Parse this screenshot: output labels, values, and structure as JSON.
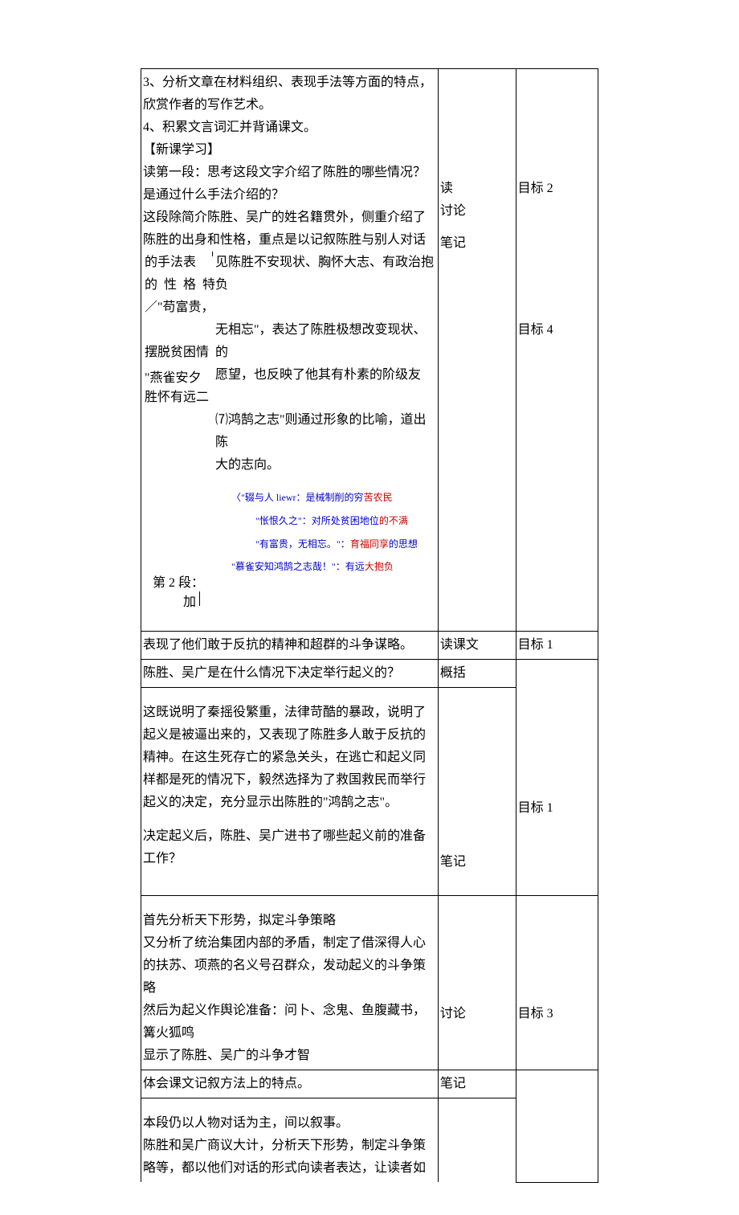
{
  "col1": {
    "points": {
      "p3": "3、分析文章在材料组织、表现手法等方面的特点，欣赏作者的写作艺术。",
      "p4": "4、积累文言词汇并背诵课文。"
    },
    "sectionHead": "【新课学习】",
    "q1": "读第一段：思考这段文字介绍了陈胜的哪些情况？是通过什么手法介绍的？",
    "block1": {
      "line1": "这段除简介陈胜、吴广的姓名籍贯外，侧重介绍了陈胜的出身和性格，重点是以记叙陈胜与别人对话",
      "left0": "的手法表",
      "right0": "见陈胜不安现状、胸怀大志、有政治抱负",
      "left1pre": "的 性 格 特",
      "left1": "／\"苟富贵，",
      "right1": "无相忘\"，表达了陈胜极想改变现状、的",
      "left2": "摆脱贫困情",
      "right2": "愿望，也反映了他其有朴素的阶级友",
      "left3a": "\"燕雀安夕",
      "left3b": "胜怀有远二",
      "right3a": "⑺鸿鹄之志\"则通过形象的比喻，道出陈",
      "right3b": "大的志向。"
    },
    "annot": {
      "a1a": "〈\"辍与人 liewr：是械制削的穷",
      "a1b": "苦农民",
      "a2a": "\"怅恨久之\"：对所处贫困地位",
      "a2b": "的不满",
      "a3a": "\"有富贵，无相忘。\"：",
      "a3b": "育福同享",
      "a3c": "的思想",
      "a4a": "\"慕雀安知鸿鹄之志哉！\"：有远",
      "a4b": "大抱负"
    },
    "footer": {
      "f1": "第 2 段：",
      "f2": "加"
    },
    "row2": "表现了他们敢于反抗的精神和超群的斗争谋略。",
    "row3": "陈胜、吴广是在什么情况下决定举行起义的？",
    "row4": {
      "l1": "这既说明了秦摇役繁重，法律苛酷的暴政，说明了起义是被逼出来的，又表现了陈胜多人敢于反抗的精神。在这生死存亡的紧急关头，在逃亡和起义同样都是死的情况下，毅然选择为了救国救民而举行",
      "l2": "起义的决定，充分显示出陈胜的\"鸿鹄之志\"。",
      "l3": "决定起义后，陈胜、吴广进书了哪些起义前的准备工作？"
    },
    "row5": {
      "l1": "首先分析天下形势，拟定斗争策略",
      "l2": "又分析了统治集团内部的矛盾，制定了借深得人心的扶苏、项燕的名义号召群众，发动起义的斗争策略",
      "l3": "然后为起义作舆论准备：问卜、念鬼、鱼腹藏书，篝火狐鸣",
      "l4": "显示了陈胜、吴广的斗争才智"
    },
    "row6": "体会课文记叙方法上的特点。",
    "row7": {
      "l1": "本段仍以人物对话为主，间以叙事。",
      "l2": "陈胜和吴广商议大计，分析天下形势，制定斗争策略等，都以他们对话的形式向读者表达，让读者如"
    }
  },
  "col2": {
    "r1a": "读",
    "r1b": "讨论",
    "r1c": "笔记",
    "r2": "读课文",
    "r3": "概括",
    "r4": "笔记",
    "r5": "讨论",
    "r6": "笔记"
  },
  "col3": {
    "r1a": "目标 2",
    "r1b": "目标 4",
    "r2": "目标 1",
    "r4": "目标 1",
    "r5": "目标 3"
  }
}
